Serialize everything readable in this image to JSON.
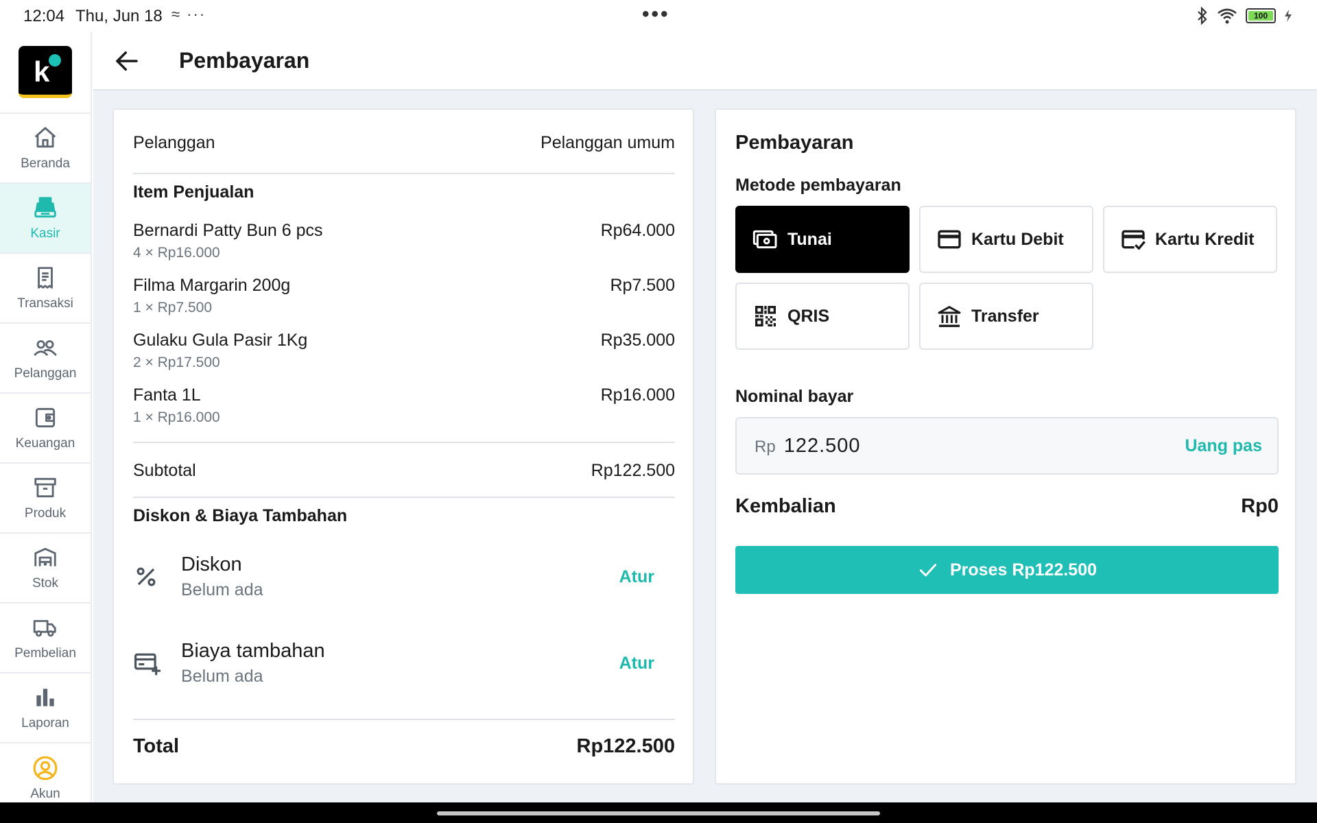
{
  "status_bar": {
    "time": "12:04",
    "date": "Thu, Jun 18",
    "notification_icons": "≈ ···",
    "center_dots": "•••",
    "battery_level": "100"
  },
  "sidebar": {
    "logo_letter": "k",
    "items": [
      {
        "label": "Beranda",
        "icon": "home-icon"
      },
      {
        "label": "Kasir",
        "icon": "cash-register-icon"
      },
      {
        "label": "Transaksi",
        "icon": "receipt-icon"
      },
      {
        "label": "Pelanggan",
        "icon": "users-icon"
      },
      {
        "label": "Keuangan",
        "icon": "wallet-icon"
      },
      {
        "label": "Produk",
        "icon": "archive-box-icon"
      },
      {
        "label": "Stok",
        "icon": "warehouse-icon"
      },
      {
        "label": "Pembelian",
        "icon": "truck-icon"
      },
      {
        "label": "Laporan",
        "icon": "bar-chart-icon"
      },
      {
        "label": "Akun",
        "icon": "account-circle-icon"
      }
    ],
    "active_item": "Kasir"
  },
  "header": {
    "title": "Pembayaran"
  },
  "order": {
    "customer_label": "Pelanggan",
    "customer_value": "Pelanggan umum",
    "items_title": "Item Penjualan",
    "items": [
      {
        "name": "Bernardi Patty Bun 6 pcs",
        "qty_price": "4 × Rp16.000",
        "total": "Rp64.000"
      },
      {
        "name": "Filma Margarin 200g",
        "qty_price": "1 × Rp7.500",
        "total": "Rp7.500"
      },
      {
        "name": "Gulaku Gula Pasir 1Kg",
        "qty_price": "2 × Rp17.500",
        "total": "Rp35.000"
      },
      {
        "name": "Fanta 1L",
        "qty_price": "1 × Rp16.000",
        "total": "Rp16.000"
      }
    ],
    "subtotal_label": "Subtotal",
    "subtotal_value": "Rp122.500",
    "adjustments_title": "Diskon & Biaya Tambahan",
    "discount": {
      "title": "Diskon",
      "status": "Belum ada",
      "action": "Atur"
    },
    "extra_fee": {
      "title": "Biaya tambahan",
      "status": "Belum ada",
      "action": "Atur"
    },
    "total_label": "Total",
    "total_value": "Rp122.500"
  },
  "payment": {
    "title": "Pembayaran",
    "method_label": "Metode pembayaran",
    "methods": [
      {
        "label": "Tunai",
        "icon": "cash-icon",
        "selected": true
      },
      {
        "label": "Kartu Debit",
        "icon": "debit-card-icon",
        "selected": false
      },
      {
        "label": "Kartu Kredit",
        "icon": "credit-card-check-icon",
        "selected": false
      },
      {
        "label": "QRIS",
        "icon": "qr-code-icon",
        "selected": false
      },
      {
        "label": "Transfer",
        "icon": "bank-icon",
        "selected": false
      }
    ],
    "amount_label": "Nominal bayar",
    "amount_prefix": "Rp",
    "amount_value": "122.500",
    "exact_amount_button": "Uang pas",
    "change_label": "Kembalian",
    "change_value": "Rp0",
    "process_button": "Proses Rp122.500"
  },
  "colors": {
    "accent": "#1fbfb6",
    "active_nav_bg": "#e6f8f6",
    "selected_method_bg": "#000000",
    "logo_underline": "#f4c21c"
  }
}
